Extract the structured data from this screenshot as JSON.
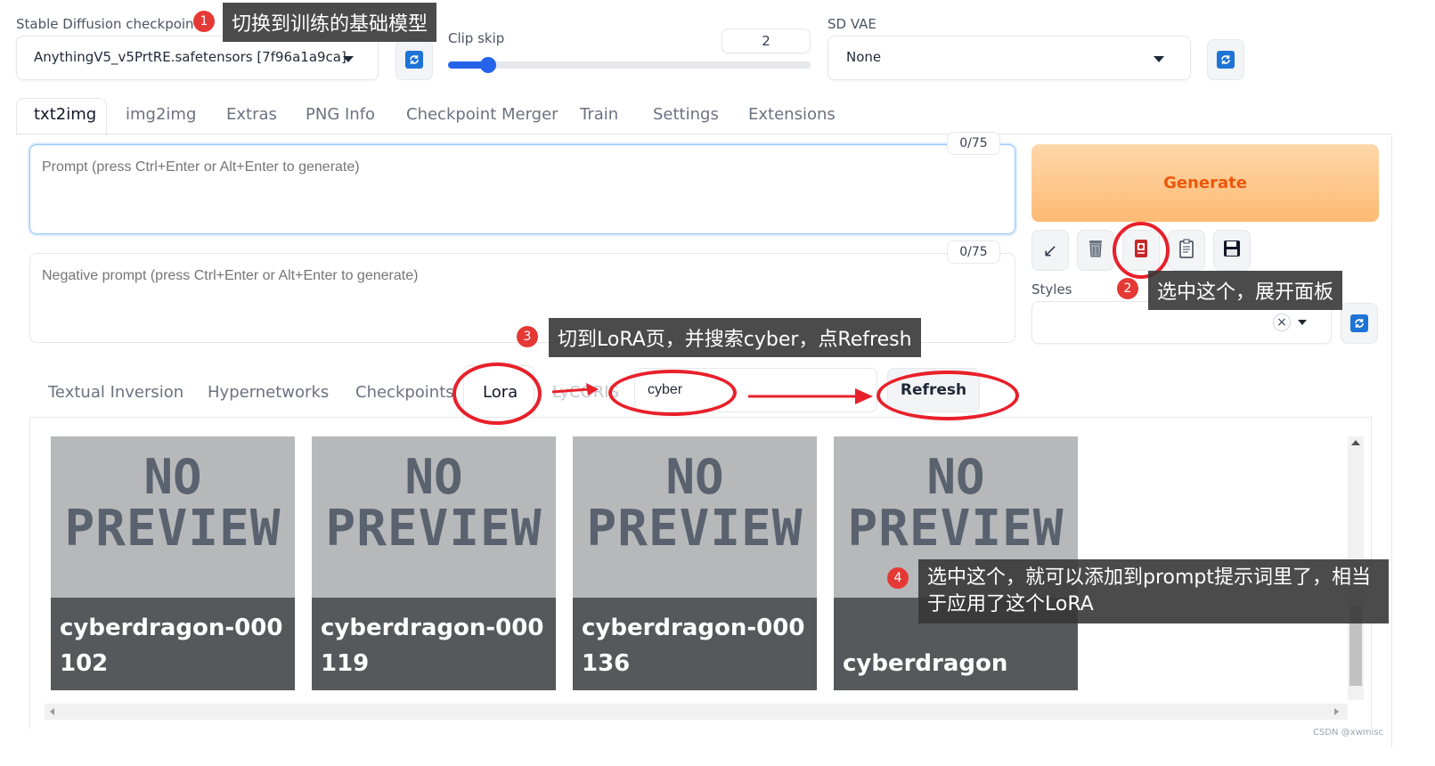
{
  "top": {
    "checkpoint_label": "Stable Diffusion checkpoint",
    "checkpoint_value": "AnythingV5_v5PrtRE.safetensors [7f96a1a9ca]",
    "clip_skip_label": "Clip skip",
    "clip_skip_value": "2",
    "clip_skip_fraction": 0.1,
    "vae_label": "SD VAE",
    "vae_value": "None"
  },
  "tabs": [
    "txt2img",
    "img2img",
    "Extras",
    "PNG Info",
    "Checkpoint Merger",
    "Train",
    "Settings",
    "Extensions"
  ],
  "prompt": {
    "placeholder": "Prompt (press Ctrl+Enter or Alt+Enter to generate)",
    "counter": "0/75"
  },
  "negative_prompt": {
    "placeholder": "Negative prompt (press Ctrl+Enter or Alt+Enter to generate)",
    "counter": "0/75"
  },
  "generate_label": "Generate",
  "styles_label": "Styles",
  "styles_clear": "×",
  "network_tabs": [
    "Textual Inversion",
    "Hypernetworks",
    "Checkpoints",
    "Lora",
    "LyCORIS"
  ],
  "search_value": "cyber",
  "refresh_label": "Refresh",
  "cards": [
    {
      "no": "NO",
      "preview": "PREVIEW",
      "caption": "cyberdragon-000102"
    },
    {
      "no": "NO",
      "preview": "PREVIEW",
      "caption": "cyberdragon-000119"
    },
    {
      "no": "NO",
      "preview": "PREVIEW",
      "caption": "cyberdragon-000136"
    },
    {
      "no": "NO",
      "preview": "PREVIEW",
      "caption": "cyberdragon"
    }
  ],
  "annotations": [
    {
      "num": "1",
      "text": "切换到训练的基础模型"
    },
    {
      "num": "2",
      "text": "选中这个，展开面板"
    },
    {
      "num": "3",
      "text": "切到LoRA页，并搜索cyber，点Refresh"
    },
    {
      "num": "4",
      "text": "选中这个，就可以添加到prompt提示词里了，相当于应用了这个LoRA"
    }
  ],
  "watermark": "CSDN @xwmisc",
  "colors": {
    "accent_blue": "#1e74d6",
    "generate_text": "#ea580c",
    "annotation_red": "#e8202a"
  }
}
